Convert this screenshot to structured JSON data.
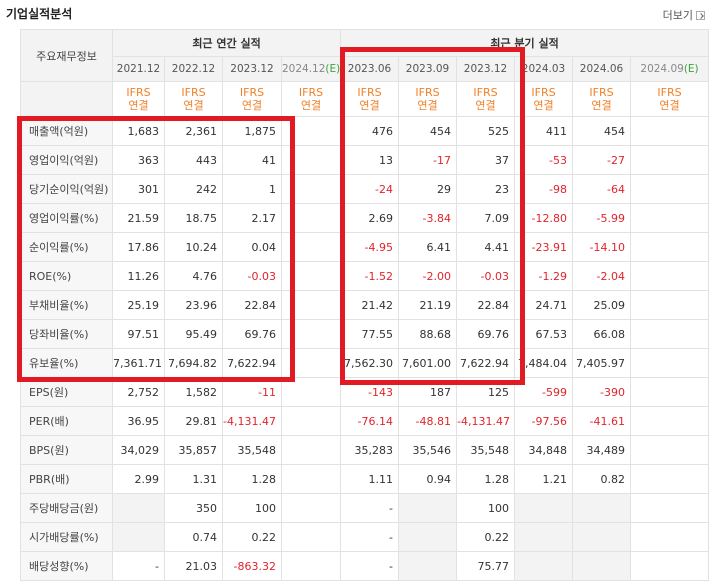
{
  "header": {
    "title": "기업실적분석",
    "more_label": "더보기"
  },
  "table": {
    "row_header_label": "주요재무정보",
    "group_annual": "최근 연간 실적",
    "group_quarter": "최근 분기 실적",
    "periods": [
      "2021.12",
      "2022.12",
      "2023.12",
      "2024.12(E)",
      "2023.06",
      "2023.09",
      "2023.12",
      "2024.03",
      "2024.06",
      "2024.09(E)"
    ],
    "basis_top": "IFRS",
    "basis_bottom": "연결",
    "rows": [
      {
        "label": "매출액(억원)",
        "values": [
          "1,683",
          "2,361",
          "1,875",
          "",
          "476",
          "454",
          "525",
          "411",
          "454",
          ""
        ]
      },
      {
        "label": "영업이익(억원)",
        "values": [
          "363",
          "443",
          "41",
          "",
          "13",
          "-17",
          "37",
          "-53",
          "-27",
          ""
        ]
      },
      {
        "label": "당기순이익(억원)",
        "values": [
          "301",
          "242",
          "1",
          "",
          "-24",
          "29",
          "23",
          "-98",
          "-64",
          ""
        ]
      },
      {
        "label": "영업이익률(%)",
        "values": [
          "21.59",
          "18.75",
          "2.17",
          "",
          "2.69",
          "-3.84",
          "7.09",
          "-12.80",
          "-5.99",
          ""
        ]
      },
      {
        "label": "순이익률(%)",
        "values": [
          "17.86",
          "10.24",
          "0.04",
          "",
          "-4.95",
          "6.41",
          "4.41",
          "-23.91",
          "-14.10",
          ""
        ]
      },
      {
        "label": "ROE(%)",
        "values": [
          "11.26",
          "4.76",
          "-0.03",
          "",
          "-1.52",
          "-2.00",
          "-0.03",
          "-1.29",
          "-2.04",
          ""
        ]
      },
      {
        "label": "부채비율(%)",
        "values": [
          "25.19",
          "23.96",
          "22.84",
          "",
          "21.42",
          "21.19",
          "22.84",
          "24.71",
          "25.09",
          ""
        ]
      },
      {
        "label": "당좌비율(%)",
        "values": [
          "97.51",
          "95.49",
          "69.76",
          "",
          "77.55",
          "88.68",
          "69.76",
          "67.53",
          "66.08",
          ""
        ]
      },
      {
        "label": "유보율(%)",
        "values": [
          "7,361.71",
          "7,694.82",
          "7,622.94",
          "",
          "7,562.30",
          "7,601.00",
          "7,622.94",
          "7,484.04",
          "7,405.97",
          ""
        ]
      },
      {
        "label": "EPS(원)",
        "values": [
          "2,752",
          "1,582",
          "-11",
          "",
          "-143",
          "187",
          "125",
          "-599",
          "-390",
          ""
        ]
      },
      {
        "label": "PER(배)",
        "values": [
          "36.95",
          "29.81",
          "-4,131.47",
          "",
          "-76.14",
          "-48.81",
          "-4,131.47",
          "-97.56",
          "-41.61",
          ""
        ]
      },
      {
        "label": "BPS(원)",
        "values": [
          "34,029",
          "35,857",
          "35,548",
          "",
          "35,283",
          "35,546",
          "35,548",
          "34,848",
          "34,489",
          ""
        ]
      },
      {
        "label": "PBR(배)",
        "values": [
          "2.99",
          "1.31",
          "1.28",
          "",
          "1.11",
          "0.94",
          "1.28",
          "1.21",
          "0.82",
          ""
        ]
      },
      {
        "label": "주당배당금(원)",
        "values": [
          "",
          "350",
          "100",
          "",
          "-",
          "",
          "100",
          "",
          "",
          ""
        ]
      },
      {
        "label": "시가배당률(%)",
        "values": [
          "",
          "0.74",
          "0.22",
          "",
          "-",
          "",
          "0.22",
          "",
          "",
          ""
        ]
      },
      {
        "label": "배당성향(%)",
        "values": [
          "-",
          "21.03",
          "-863.32",
          "",
          "-",
          "",
          "75.77",
          "",
          "",
          ""
        ]
      }
    ]
  },
  "colors": {
    "highlight": "#e21a23",
    "negative": "#e2242b",
    "basis": "#f08028",
    "estimate_marker": "#3aa43a"
  }
}
